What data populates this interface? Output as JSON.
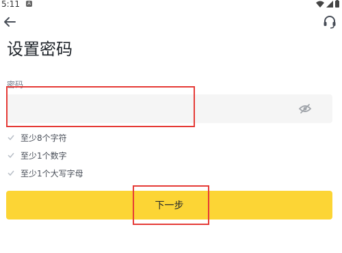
{
  "status_bar": {
    "time": "5:11",
    "notif_glyph": "A"
  },
  "header": {
    "title": "设置密码"
  },
  "password": {
    "label": "密码",
    "value": "",
    "placeholder": ""
  },
  "rules": [
    {
      "text": "至少8个字符"
    },
    {
      "text": "至少1个数字"
    },
    {
      "text": "至少1个大写字母"
    }
  ],
  "actions": {
    "next_label": "下一步"
  },
  "colors": {
    "accent": "#fcd535",
    "field_bg": "#f5f5f5",
    "highlight": "#e53935"
  },
  "icons": [
    "back-arrow-icon",
    "headset-icon",
    "eye-off-icon",
    "check-icon",
    "wifi-icon",
    "battery-icon"
  ]
}
